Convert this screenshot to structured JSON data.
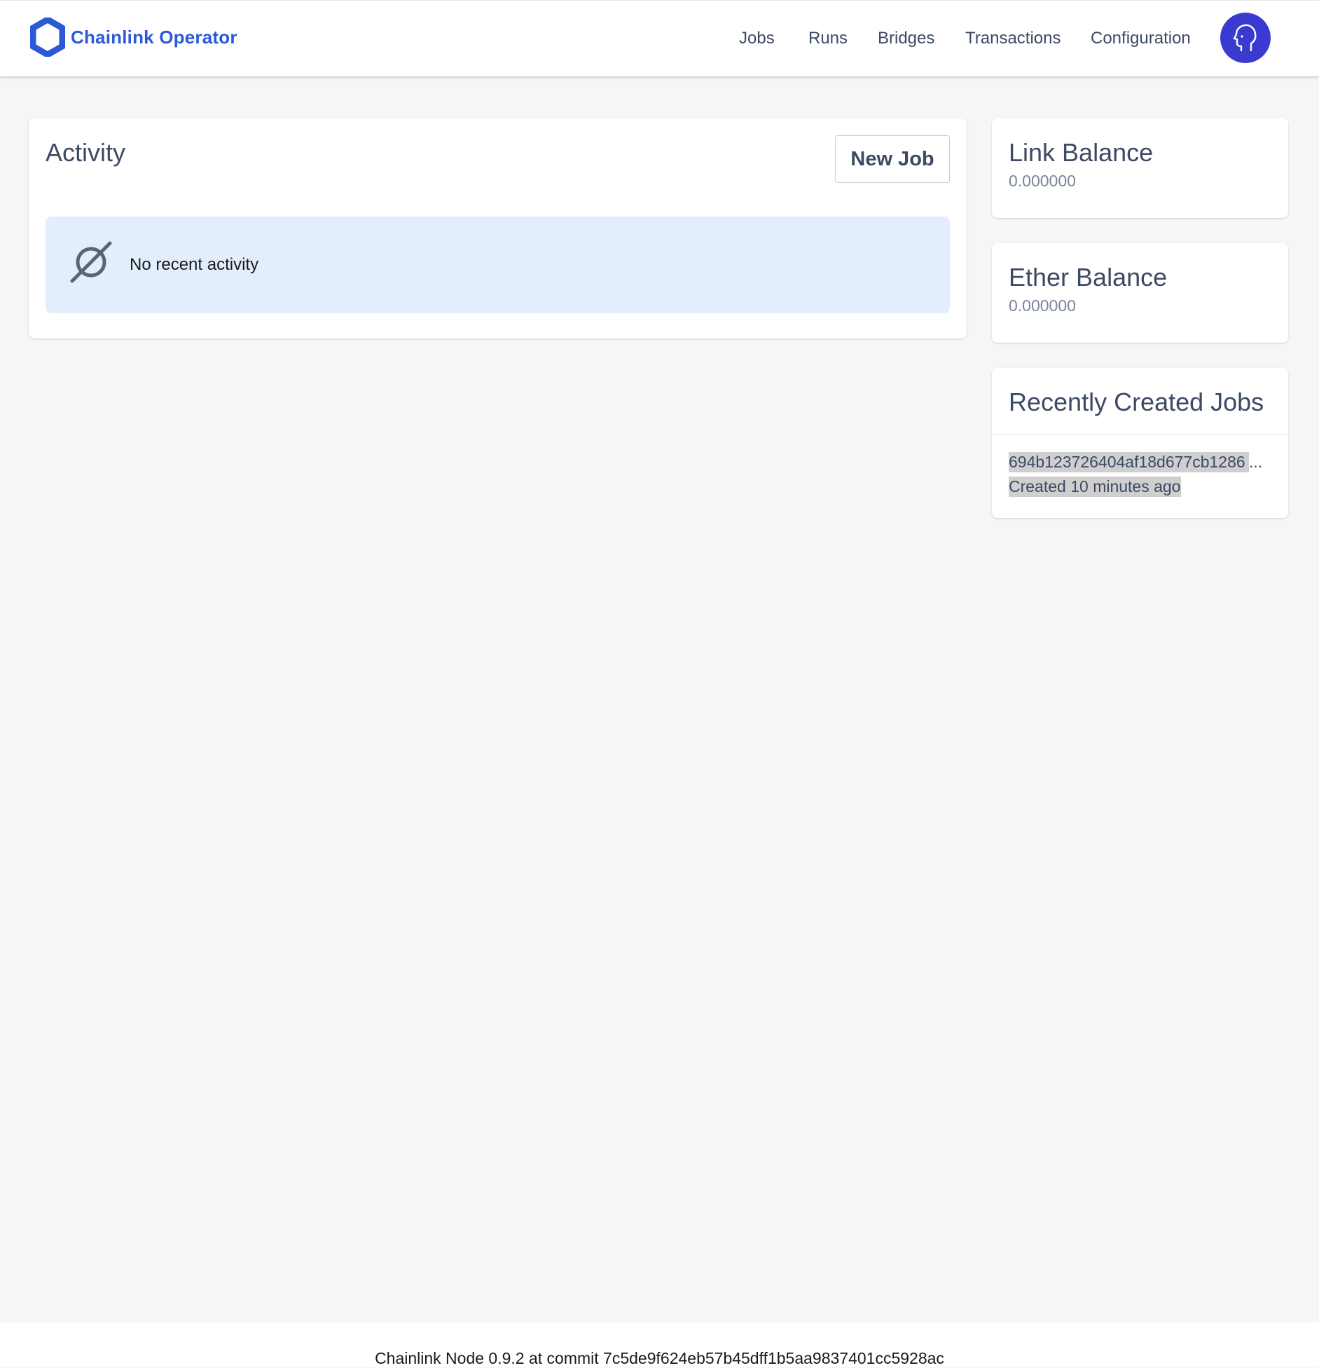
{
  "header": {
    "brand": "Chainlink Operator",
    "brand_color": "#2a5ada",
    "logo_icon": "chainlink-hexagon-icon",
    "nav": [
      {
        "label": "Jobs"
      },
      {
        "label": "Runs"
      },
      {
        "label": "Bridges"
      },
      {
        "label": "Transactions"
      },
      {
        "label": "Configuration"
      }
    ],
    "avatar_icon": "user-head-icon",
    "avatar_color": "#3a3ad0"
  },
  "activity": {
    "title": "Activity",
    "new_job_label": "New Job",
    "empty_icon": "empty-set-icon",
    "empty_text": "No recent activity"
  },
  "link_balance": {
    "title": "Link Balance",
    "value": "0.000000"
  },
  "ether_balance": {
    "title": "Ether Balance",
    "value": "0.000000"
  },
  "recent_jobs": {
    "title": "Recently Created Jobs",
    "items": [
      {
        "id": "694b123726404af18d677cb1286",
        "ellipsis": "...",
        "created": "Created 10 minutes ago"
      }
    ]
  },
  "footer": {
    "text": "Chainlink Node 0.9.2 at commit 7c5de9f624eb57b45dff1b5aa9837401cc5928ac"
  }
}
